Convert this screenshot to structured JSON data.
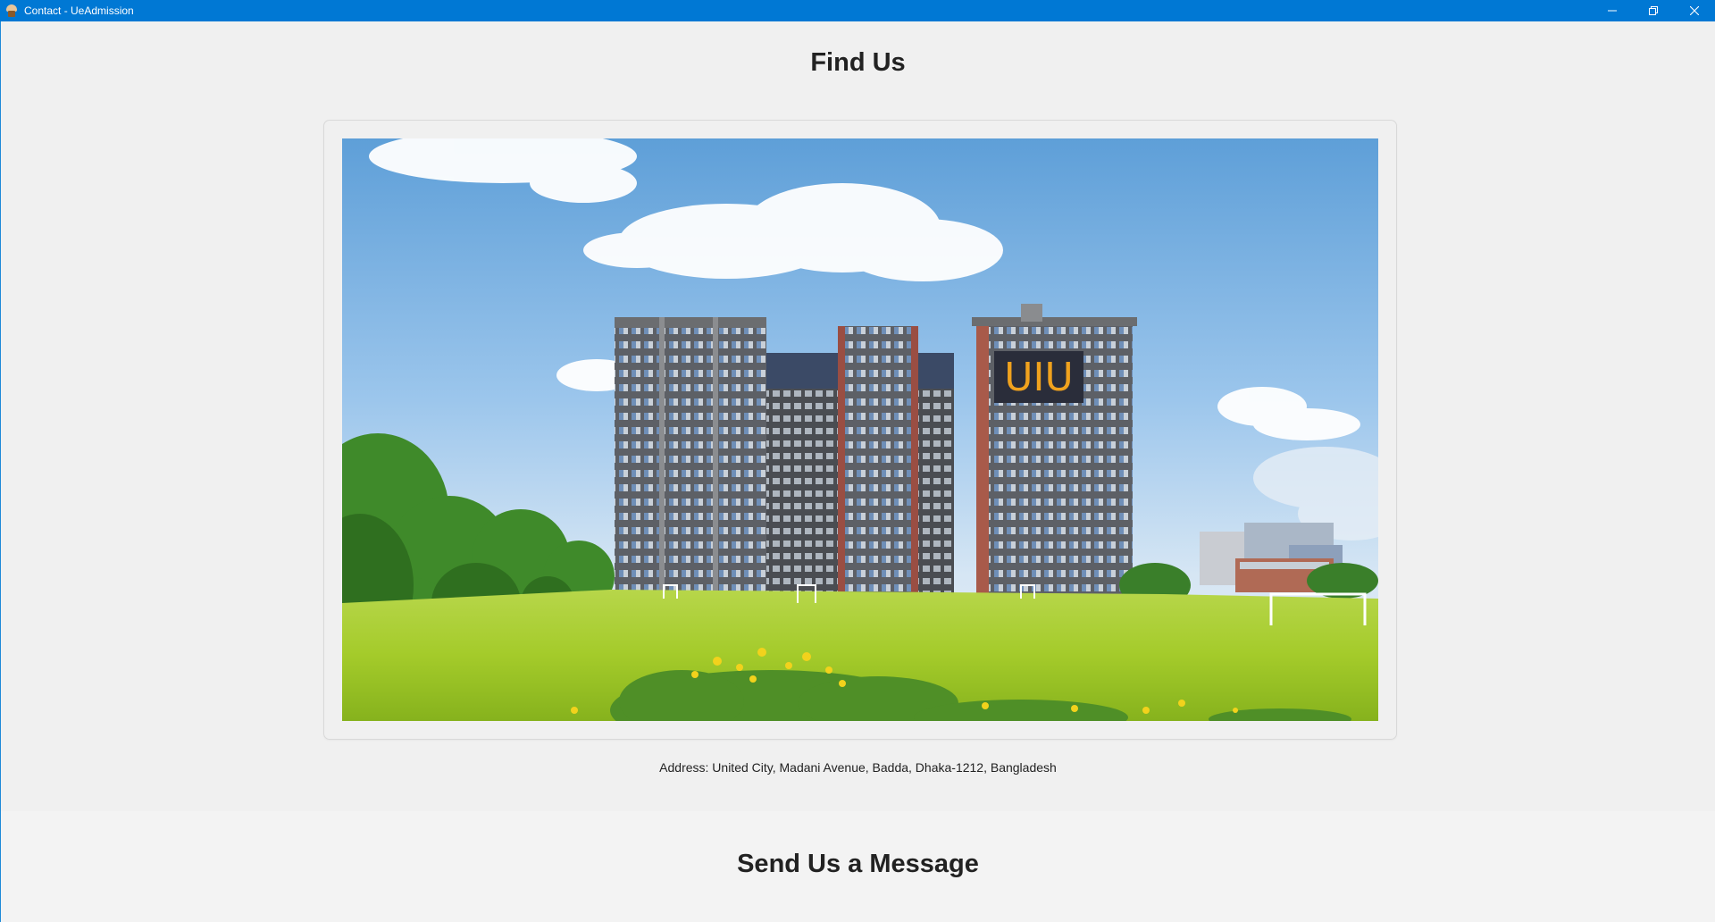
{
  "window": {
    "title": "Contact - UeAdmission",
    "controls": {
      "minimize_icon": "minimize-icon",
      "restore_icon": "restore-icon",
      "close_icon": "close-icon"
    }
  },
  "find_us": {
    "title": "Find Us",
    "image_sign": "UIU",
    "address": "Address: United City, Madani Avenue, Badda, Dhaka-1212, Bangladesh"
  },
  "send_message": {
    "title": "Send Us a Message"
  },
  "colors": {
    "titlebar": "#0078d4",
    "background": "#f0f0f0",
    "sign_text": "#f0a21e"
  }
}
